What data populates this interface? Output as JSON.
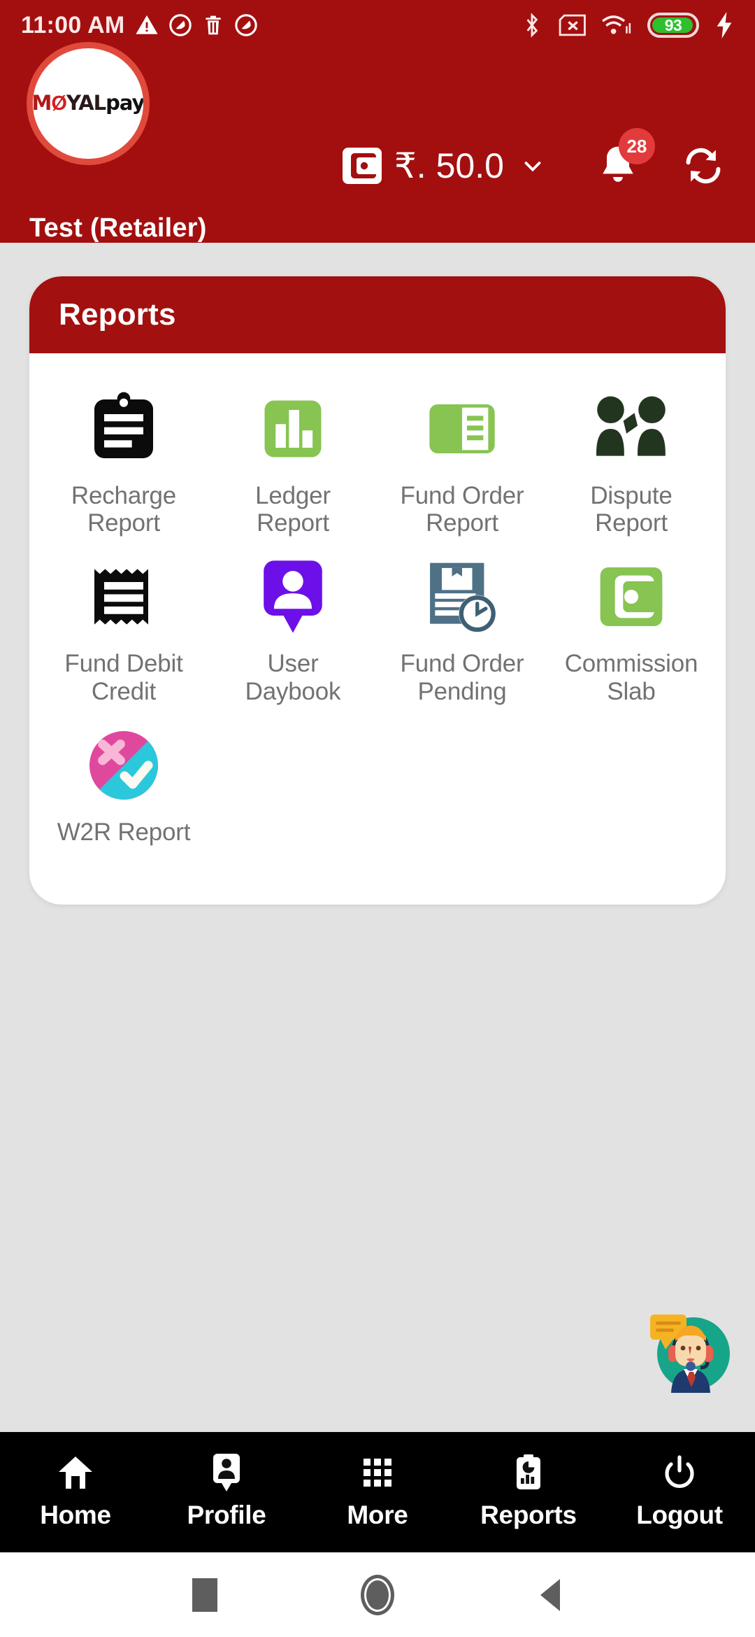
{
  "status_bar": {
    "time": "11:00 AM",
    "left_icons": [
      "warning-triangle-icon",
      "do-not-disturb-icon",
      "trash-icon",
      "do-not-disturb-icon"
    ],
    "right_icons": [
      "bluetooth-icon",
      "sim-card-off-icon",
      "wifi-icon",
      "battery-icon",
      "charging-bolt-icon"
    ],
    "battery_percent": "93"
  },
  "header": {
    "logo_mo": "M",
    "logo_o": "Ø",
    "logo_yal": "YAL",
    "logo_pay": "pay",
    "balance": "₹. 50.0",
    "notification_count": "28",
    "username": "Test (Retailer)",
    "brand_color": "#A30F0F",
    "logo_ring_color": "#E04A3C"
  },
  "card": {
    "title": "Reports",
    "header_color": "#A31010",
    "tiles": [
      {
        "label": "Recharge Report",
        "icon": "clipboard-lines-icon",
        "color": "#0B0B0B"
      },
      {
        "label": "Ledger Report",
        "icon": "bar-chart-icon",
        "color": "#87C452"
      },
      {
        "label": "Fund Order Report",
        "icon": "document-green-icon",
        "color": "#87C452"
      },
      {
        "label": "Dispute Report",
        "icon": "two-people-arguing-icon",
        "color": "#22351F"
      },
      {
        "label": "Fund Debit Credit",
        "icon": "receipt-icon",
        "color": "#0B0B0B"
      },
      {
        "label": "User Daybook",
        "icon": "user-pin-icon",
        "color": "#6D0FE8"
      },
      {
        "label": "Fund Order Pending",
        "icon": "document-clock-icon",
        "color": "#4F7186"
      },
      {
        "label": "Commission Slab",
        "icon": "wallet-green-icon",
        "color": "#87C452"
      },
      {
        "label": "W2R Report",
        "icon": "cross-check-circle-icon",
        "color": "#E0489E"
      }
    ]
  },
  "support": {
    "icon": "support-agent-icon",
    "circle_color": "#17A589"
  },
  "bottom_nav": {
    "items": [
      {
        "label": "Home",
        "icon": "home-icon"
      },
      {
        "label": "Profile",
        "icon": "profile-badge-icon"
      },
      {
        "label": "More",
        "icon": "grid-dots-icon"
      },
      {
        "label": "Reports",
        "icon": "clipboard-chart-icon"
      },
      {
        "label": "Logout",
        "icon": "power-icon"
      }
    ]
  },
  "android_nav": {
    "items": [
      "recents-square-icon",
      "home-circle-icon",
      "back-triangle-icon"
    ]
  }
}
